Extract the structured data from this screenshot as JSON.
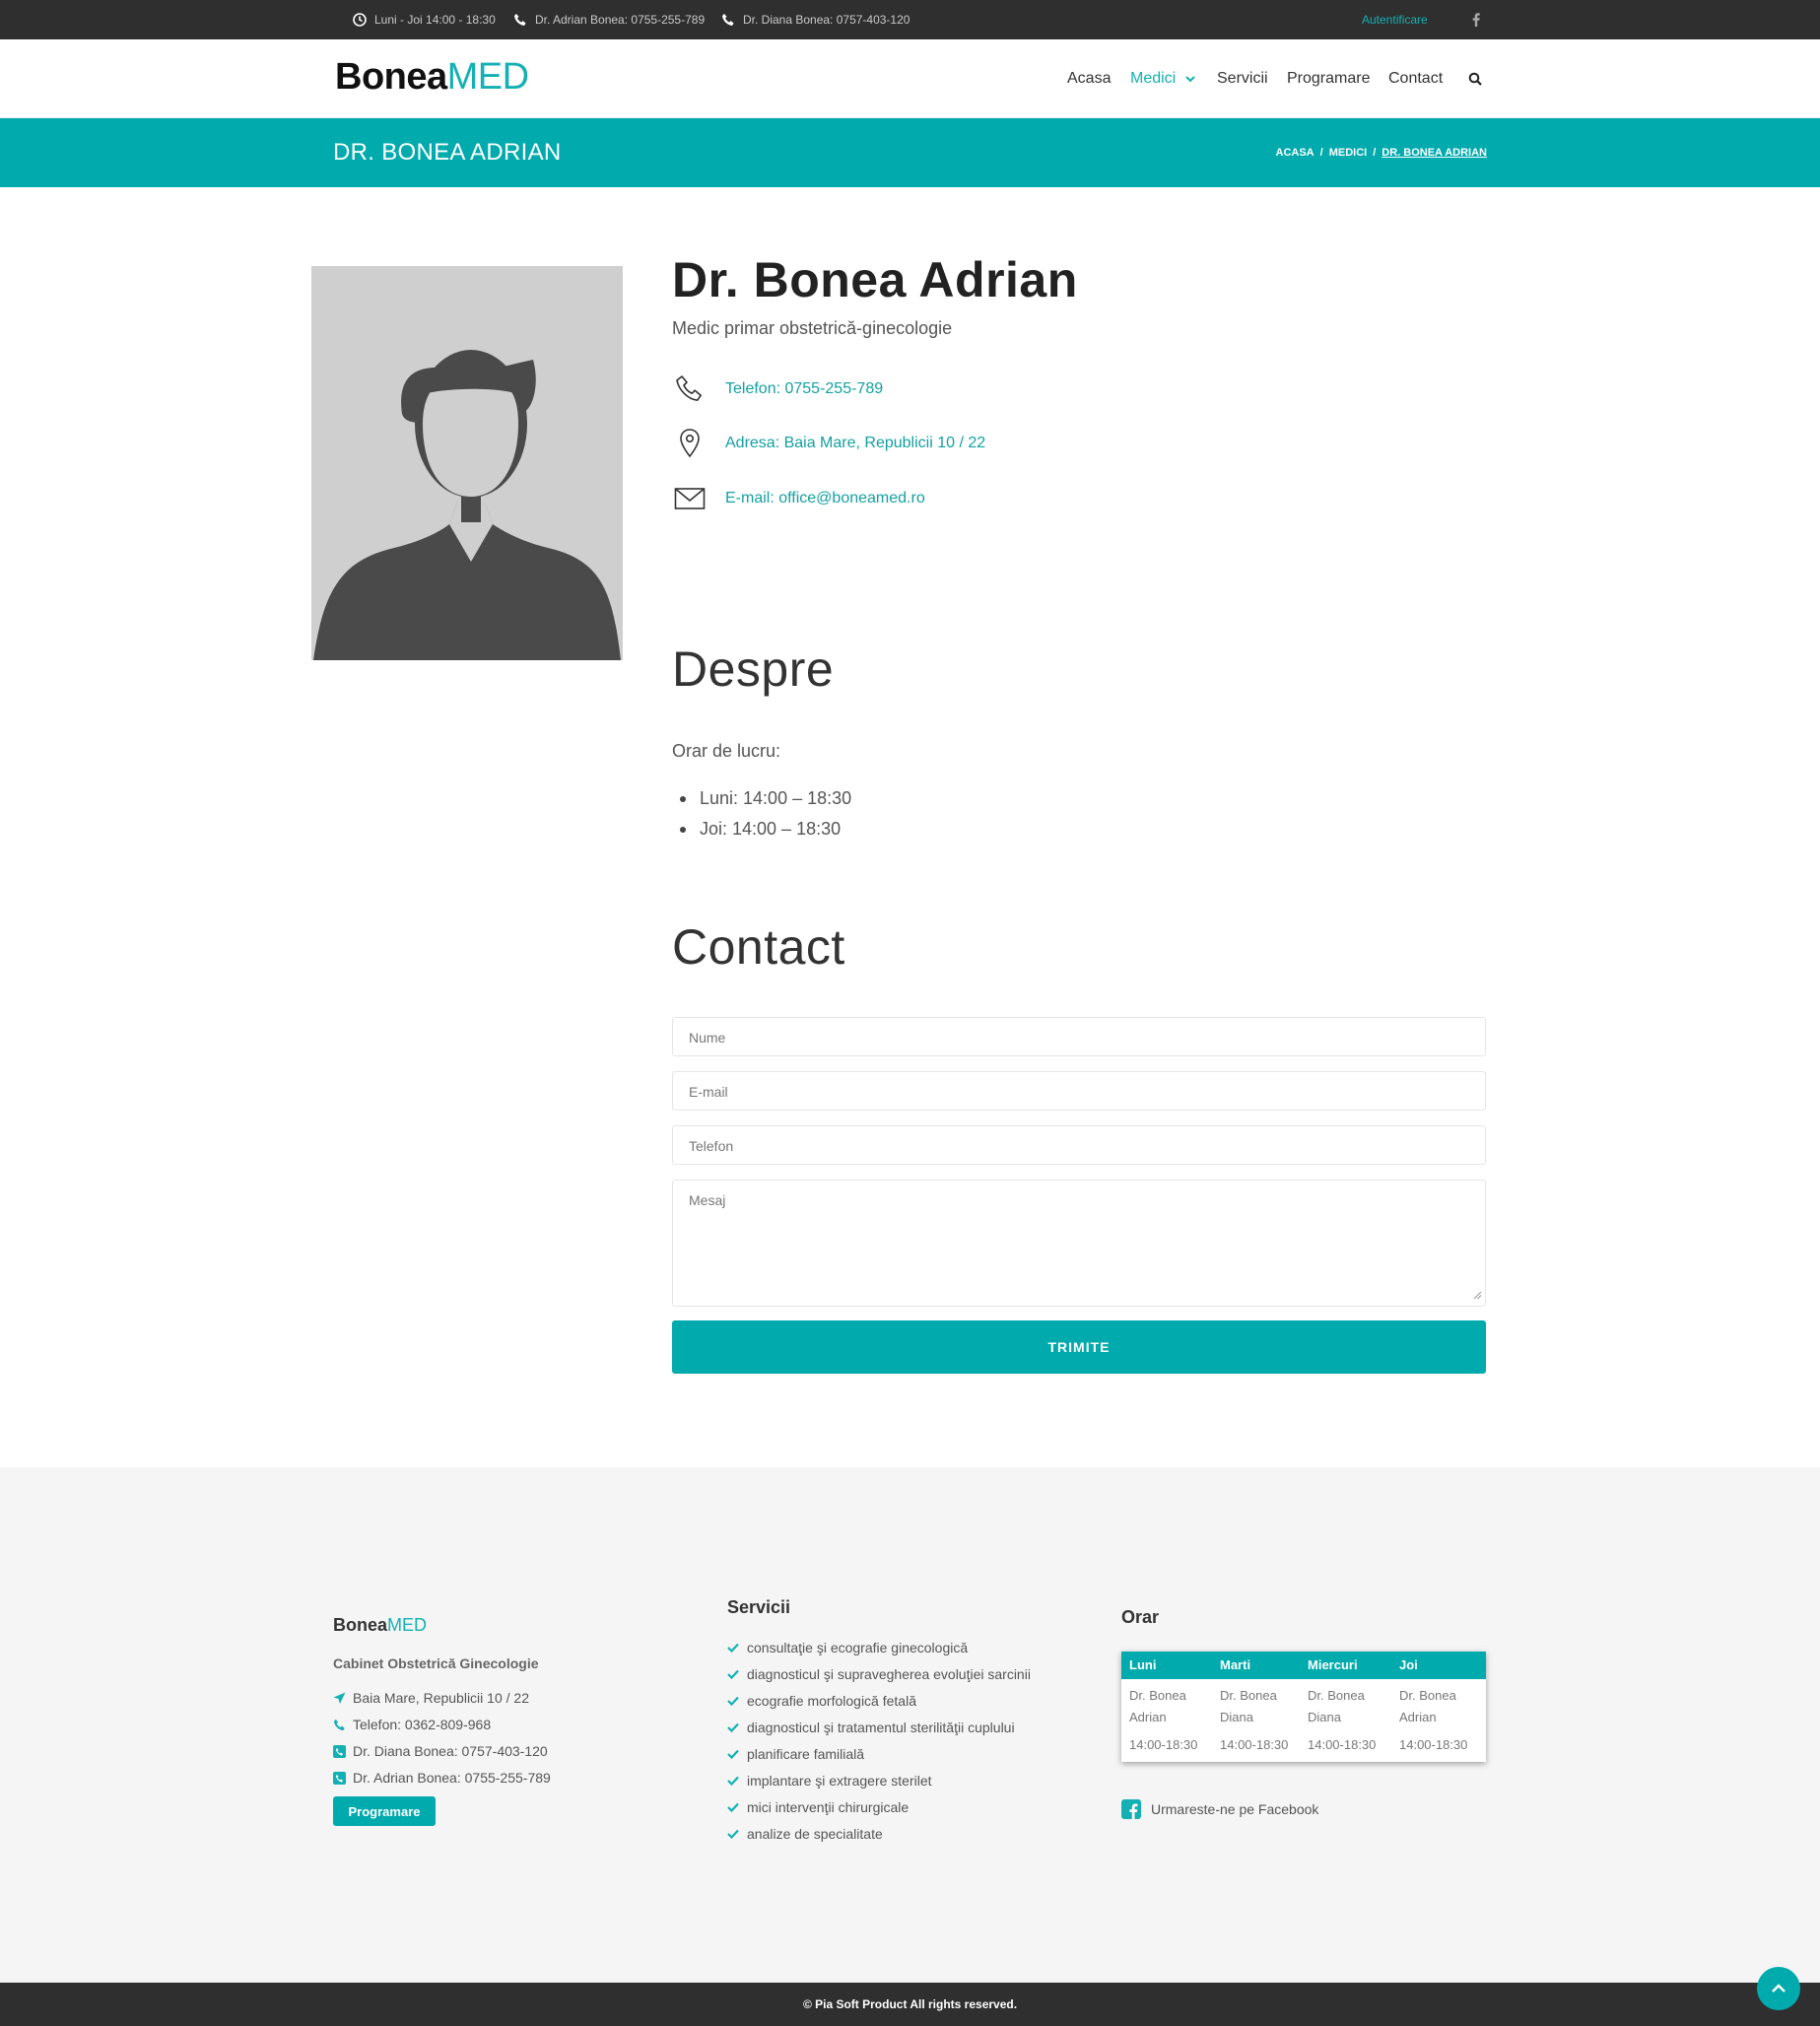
{
  "topbar": {
    "hours": "Luni - Joi 14:00 - 18:30",
    "phone_adrian": "Dr. Adrian Bonea: 0755-255-789",
    "phone_diana": "Dr. Diana Bonea: 0757-403-120",
    "login": "Autentificare"
  },
  "logo": {
    "part1": "Bonea",
    "part2": "MED"
  },
  "nav": {
    "home": "Acasa",
    "doctors": "Medici",
    "services": "Servicii",
    "appointment": "Programare",
    "contact": "Contact"
  },
  "page": {
    "title": "DR. BONEA ADRIAN",
    "breadcrumb": {
      "home": "ACASA",
      "sep": "/",
      "section": "MEDICI",
      "current": "DR. BONEA ADRIAN"
    }
  },
  "doctor": {
    "name": "Dr. Bonea Adrian",
    "specialty": "Medic primar obstetrică-ginecologie",
    "phone": "Telefon: 0755-255-789",
    "address": "Adresa: Baia Mare, Republicii 10 / 22",
    "email": "E-mail: office@boneamed.ro"
  },
  "about": {
    "heading": "Despre",
    "schedule_label": "Orar de lucru:",
    "schedule": [
      "Luni: 14:00 – 18:30",
      "Joi: 14:00 – 18:30"
    ]
  },
  "contact_form": {
    "heading": "Contact",
    "name_placeholder": "Nume",
    "email_placeholder": "E-mail",
    "phone_placeholder": "Telefon",
    "message_placeholder": "Mesaj",
    "submit": "TRIMITE"
  },
  "footer": {
    "logo1": "Bonea",
    "logo2": "MED",
    "subtitle": "Cabinet Obstetrică Ginecologie",
    "address": "Baia Mare, Republicii 10 / 22",
    "phone": "Telefon: 0362-809-968",
    "diana": "Dr. Diana Bonea: 0757-403-120",
    "adrian": "Dr. Adrian Bonea: 0755-255-789",
    "button": "Programare",
    "services_heading": "Servicii",
    "services": [
      "consultaţie şi ecografie ginecologică",
      "diagnosticul şi supravegherea evoluţiei sarcinii",
      "ecografie morfologică fetală",
      "diagnosticul şi tratamentul sterilităţii cuplului",
      "planificare familială",
      "implantare şi extragere sterilet",
      "mici intervenţii chirurgicale",
      "analize de specialitate"
    ],
    "schedule_heading": "Orar",
    "schedule_table": {
      "headers": [
        "Luni",
        "Marti",
        "Miercuri",
        "Joi"
      ],
      "doctors": [
        [
          "Dr. Bonea",
          "Adrian"
        ],
        [
          "Dr. Bonea",
          "Diana"
        ],
        [
          "Dr. Bonea",
          "Diana"
        ],
        [
          "Dr. Bonea",
          "Adrian"
        ]
      ],
      "hours": [
        "14:00-18:30",
        "14:00-18:30",
        "14:00-18:30",
        "14:00-18:30"
      ]
    },
    "facebook": "Urmareste-ne pe Facebook",
    "copyright": "© Pia Soft Product All rights reserved."
  },
  "colors": {
    "accent": "#00aaad",
    "dark_bar": "#2f2f2f",
    "footer_bg": "#f5f5f5"
  },
  "icons": [
    "clock-icon",
    "phone-icon",
    "facebook-icon",
    "search-icon",
    "chevron-down-icon",
    "location-pin-icon",
    "envelope-icon",
    "paper-plane-icon",
    "check-icon",
    "arrow-up-icon"
  ]
}
